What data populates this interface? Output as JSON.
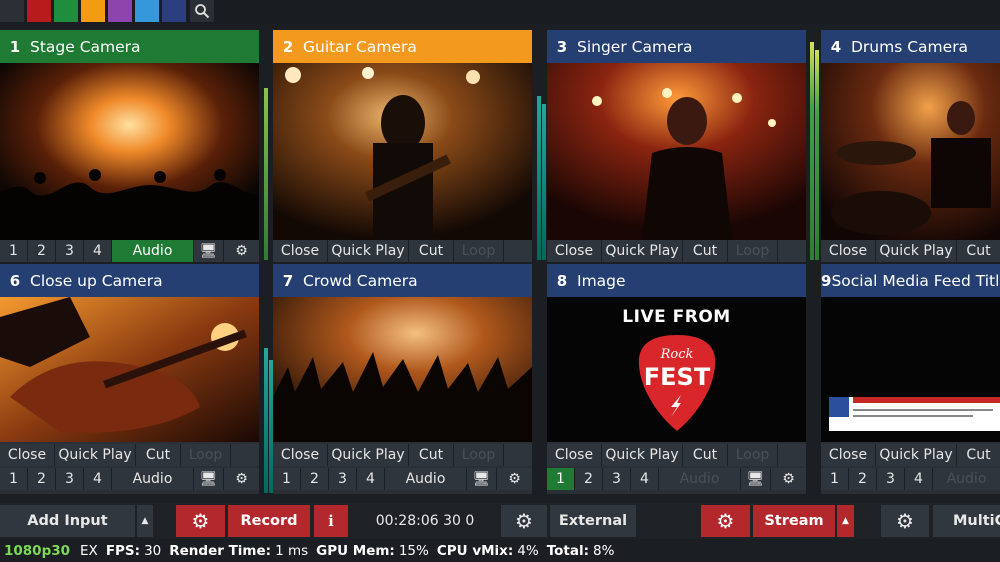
{
  "topbar": {
    "swatches": [
      "#2b3036",
      "#b71c1c",
      "#1e8e3e",
      "#f39c12",
      "#8e44ad",
      "#3498db",
      "#2c3e80"
    ],
    "search_icon": "search-icon"
  },
  "tiles": [
    {
      "number": "1",
      "title": "Stage Camera",
      "header_color": "#1f7a33",
      "audio_active": true,
      "preview": "concert-stage"
    },
    {
      "number": "2",
      "title": "Guitar Camera",
      "header_color": "#f39a1e",
      "audio_active": false,
      "preview": "guitarist"
    },
    {
      "number": "3",
      "title": "Singer Camera",
      "header_color": "#263f72",
      "audio_active": true,
      "preview": "singer"
    },
    {
      "number": "4",
      "title": "Drums Camera",
      "header_color": "#263f72",
      "audio_active": false,
      "preview": "drummer"
    },
    {
      "number": "6",
      "title": "Close up Camera",
      "header_color": "#263f72",
      "audio_active": false,
      "preview": "guitar-closeup"
    },
    {
      "number": "7",
      "title": "Crowd Camera",
      "header_color": "#263f72",
      "audio_active": false,
      "preview": "crowd"
    },
    {
      "number": "8",
      "title": "Image",
      "header_color": "#263f72",
      "audio_active": false,
      "preview": "logo"
    },
    {
      "number": "9",
      "title": "Social Media Feed Title",
      "header_color": "#263f72",
      "audio_active": false,
      "preview": "social"
    }
  ],
  "controls": {
    "close": "Close",
    "quick_play": "Quick Play",
    "cut": "Cut",
    "loop": "Loop",
    "overlay": [
      "1",
      "2",
      "3",
      "4"
    ],
    "audio": "Audio"
  },
  "image_tile": {
    "live_from": "LIVE FROM",
    "rock": "Rock",
    "fest": "FEST"
  },
  "bottombar": {
    "add_input": "Add Input",
    "record": "Record",
    "info": "i",
    "timecode": "00:28:06 30 0",
    "external": "External",
    "stream": "Stream",
    "multicorder": "MultiCorder"
  },
  "status": {
    "resolution": "1080p30",
    "ex": "EX",
    "fps_label": "FPS:",
    "fps": "30",
    "render_label": "Render Time:",
    "render": "1 ms",
    "gpu_label": "GPU Mem:",
    "gpu": "15%",
    "cpu_label": "CPU vMix:",
    "cpu": "4%",
    "total_label": "Total:",
    "total": "8%"
  }
}
